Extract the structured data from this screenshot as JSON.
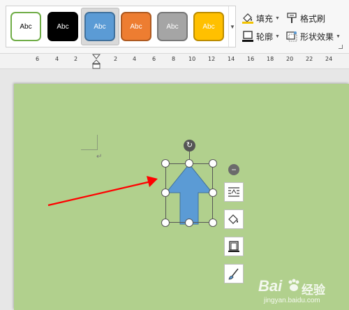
{
  "ribbon": {
    "style_gallery": [
      {
        "label": "Abc",
        "fill": "#ffffff",
        "border": "#70ad47",
        "text": "#000000"
      },
      {
        "label": "Abc",
        "fill": "#000000",
        "border": "#000000",
        "text": "#ffffff"
      },
      {
        "label": "Abc",
        "fill": "#5b9bd5",
        "border": "#41719c",
        "text": "#ffffff",
        "selected": true
      },
      {
        "label": "Abc",
        "fill": "#ed7d31",
        "border": "#ae5a21",
        "text": "#ffffff"
      },
      {
        "label": "Abc",
        "fill": "#a5a5a5",
        "border": "#787878",
        "text": "#ffffff"
      },
      {
        "label": "Abc",
        "fill": "#ffc000",
        "border": "#bc8c00",
        "text": "#ffffff"
      }
    ],
    "fill_label": "填充",
    "format_painter_label": "格式刷",
    "outline_label": "轮廓",
    "shape_effects_label": "形状效果"
  },
  "ruler": {
    "ticks": [
      "6",
      "4",
      "2",
      "2",
      "4",
      "6",
      "8",
      "10",
      "12",
      "14",
      "16",
      "18",
      "20",
      "22",
      "24"
    ]
  },
  "document": {
    "page_color": "#b1d08d",
    "shape": {
      "type": "up-arrow",
      "fill": "#5b9bd5",
      "stroke": "#41719c"
    },
    "annotation_arrow_color": "#ff0000"
  },
  "side_tools": [
    "layout-options-icon",
    "shape-fill-icon",
    "shape-outline-icon",
    "format-shape-icon"
  ],
  "watermark": {
    "brand": "Bai",
    "product": "经验",
    "url": "jingyan.baidu.com"
  }
}
